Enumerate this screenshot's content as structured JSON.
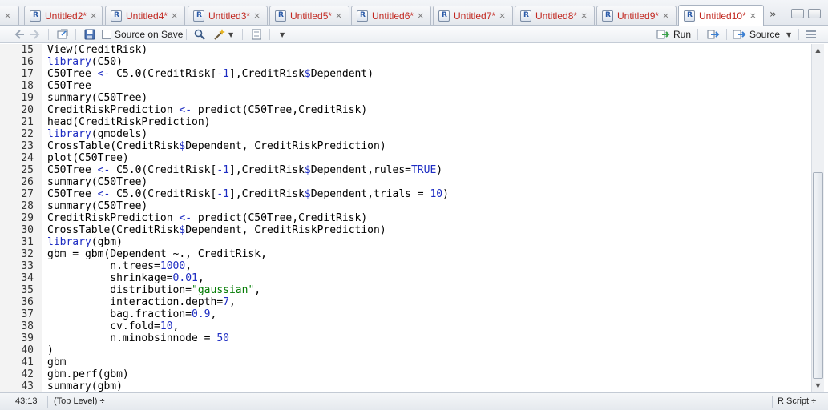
{
  "tabs": [
    {
      "label": "",
      "close": "×"
    },
    {
      "label": "Untitled2*",
      "close": "×"
    },
    {
      "label": "Untitled4*",
      "close": "×"
    },
    {
      "label": "Untitled3*",
      "close": "×"
    },
    {
      "label": "Untitled5*",
      "close": "×"
    },
    {
      "label": "Untitled6*",
      "close": "×"
    },
    {
      "label": "Untitled7*",
      "close": "×"
    },
    {
      "label": "Untitled8*",
      "close": "×"
    },
    {
      "label": "Untitled9*",
      "close": "×"
    },
    {
      "label": "Untitled10*",
      "close": "×",
      "active": true
    }
  ],
  "toolbar": {
    "source_on_save": "Source on Save",
    "run": "Run",
    "source": "Source"
  },
  "code_lines": [
    {
      "n": "15",
      "html": "View(CreditRisk)"
    },
    {
      "n": "16",
      "html": "<span class='kw'>library</span>(C50)"
    },
    {
      "n": "17",
      "html": "C50Tree <span class='kw'>&lt;-</span> C5.0(CreditRisk[<span class='num'>-1</span>],CreditRisk<span class='kw'>$</span>Dependent)"
    },
    {
      "n": "18",
      "html": "C50Tree"
    },
    {
      "n": "19",
      "html": "summary(C50Tree)"
    },
    {
      "n": "20",
      "html": "CreditRiskPrediction <span class='kw'>&lt;-</span> predict(C50Tree,CreditRisk)"
    },
    {
      "n": "21",
      "html": "head(CreditRiskPrediction)"
    },
    {
      "n": "22",
      "html": "<span class='kw'>library</span>(gmodels)"
    },
    {
      "n": "23",
      "html": "CrossTable(CreditRisk<span class='kw'>$</span>Dependent, CreditRiskPrediction)"
    },
    {
      "n": "24",
      "html": "plot(C50Tree)"
    },
    {
      "n": "25",
      "html": "C50Tree <span class='kw'>&lt;-</span> C5.0(CreditRisk[<span class='num'>-1</span>],CreditRisk<span class='kw'>$</span>Dependent,rules=<span class='num'>TRUE</span>)"
    },
    {
      "n": "26",
      "html": "summary(C50Tree)"
    },
    {
      "n": "27",
      "html": "C50Tree <span class='kw'>&lt;-</span> C5.0(CreditRisk[<span class='num'>-1</span>],CreditRisk<span class='kw'>$</span>Dependent,trials = <span class='num'>10</span>)"
    },
    {
      "n": "28",
      "html": "summary(C50Tree)"
    },
    {
      "n": "29",
      "html": "CreditRiskPrediction <span class='kw'>&lt;-</span> predict(C50Tree,CreditRisk)"
    },
    {
      "n": "30",
      "html": "CrossTable(CreditRisk<span class='kw'>$</span>Dependent, CreditRiskPrediction)"
    },
    {
      "n": "31",
      "html": "<span class='kw'>library</span>(gbm)"
    },
    {
      "n": "32",
      "html": "gbm = gbm(Dependent ~., CreditRisk,"
    },
    {
      "n": "33",
      "html": "          n.trees=<span class='num'>1000</span>,"
    },
    {
      "n": "34",
      "html": "          shrinkage=<span class='num'>0.01</span>,"
    },
    {
      "n": "35",
      "html": "          distribution=<span class='str'>\"gaussian\"</span>,"
    },
    {
      "n": "36",
      "html": "          interaction.depth=<span class='num'>7</span>,"
    },
    {
      "n": "37",
      "html": "          bag.fraction=<span class='num'>0.9</span>,"
    },
    {
      "n": "38",
      "html": "          cv.fold=<span class='num'>10</span>,"
    },
    {
      "n": "39",
      "html": "          n.minobsinnode = <span class='num'>50</span>"
    },
    {
      "n": "40",
      "html": ")"
    },
    {
      "n": "41",
      "html": "gbm"
    },
    {
      "n": "42",
      "html": "gbm.perf(gbm)"
    },
    {
      "n": "43",
      "html": "summary(gbm)"
    }
  ],
  "status": {
    "cursor": "43:13",
    "scope": "(Top Level) ÷",
    "filetype": "R Script ÷"
  }
}
